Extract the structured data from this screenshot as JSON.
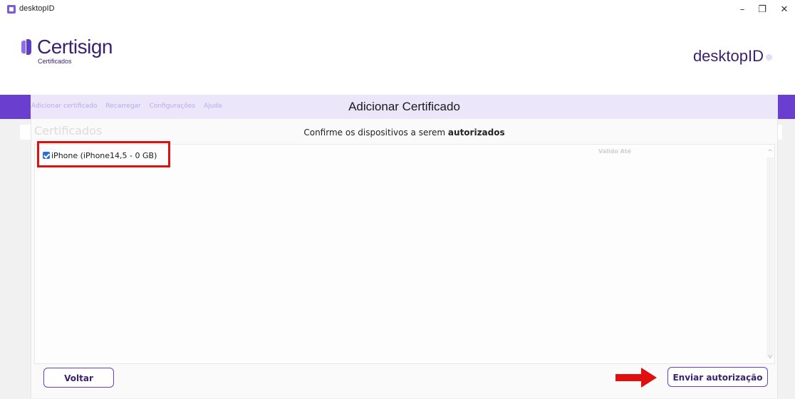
{
  "window": {
    "title": "desktopID",
    "controls": {
      "minimize": "–",
      "restore": "❐",
      "close": "✕"
    }
  },
  "header": {
    "brand": "Certisign",
    "brand_sub": "Certificados",
    "app_name": "desktopID"
  },
  "menu": {
    "items": [
      "Adicionar certificado",
      "Recarregar",
      "Configurações",
      "Ajuda"
    ]
  },
  "background": {
    "section_title": "Certificados"
  },
  "dialog": {
    "title": "Adicionar Certificado",
    "subtitle_prefix": "Confirme os dispositivos a serem ",
    "subtitle_bold": "autorizados",
    "column_header": "Válido Até",
    "devices": [
      {
        "label": "iPhone (iPhone14,5 - 0 GB)",
        "checked": true
      }
    ],
    "back_button": "Voltar",
    "send_button": "Enviar autorização"
  },
  "colors": {
    "brand_purple": "#6a3fd0",
    "header_band": "#ece6fb",
    "annotation_red": "#e01010"
  },
  "icons": [
    "app-icon",
    "info-icon",
    "checkbox-checked-icon",
    "scroll-up-icon",
    "scroll-down-icon",
    "arrow-right-annotation"
  ]
}
